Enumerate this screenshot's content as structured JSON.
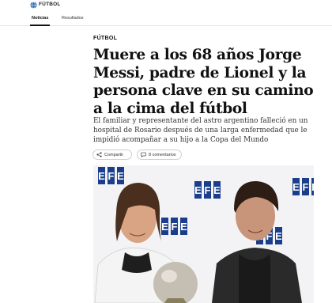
{
  "header": {
    "brand": "FÚTBOL",
    "globe_icon": "globe-icon"
  },
  "tabs": [
    {
      "label": "Noticias",
      "active": true
    },
    {
      "label": "Resultados",
      "active": false
    }
  ],
  "article": {
    "section": "FÚTBOL",
    "headline": "Muere a los 68 años Jorge Messi, padre de Lionel y la persona clave en su camino a la cima del fútbol",
    "summary": "El familiar y representante del astro argentino falleció en un hospital de Rosario después de una larga enfermedad que le impidió acompañar a su hijo a la Copa del Mundo",
    "share_label": "Compartir",
    "comments_label": "8 comentarios",
    "photo_logo_text": "EFE"
  },
  "colors": {
    "efe_blue": "#1b3e8c",
    "text": "#111111",
    "summary_text": "#333333"
  }
}
